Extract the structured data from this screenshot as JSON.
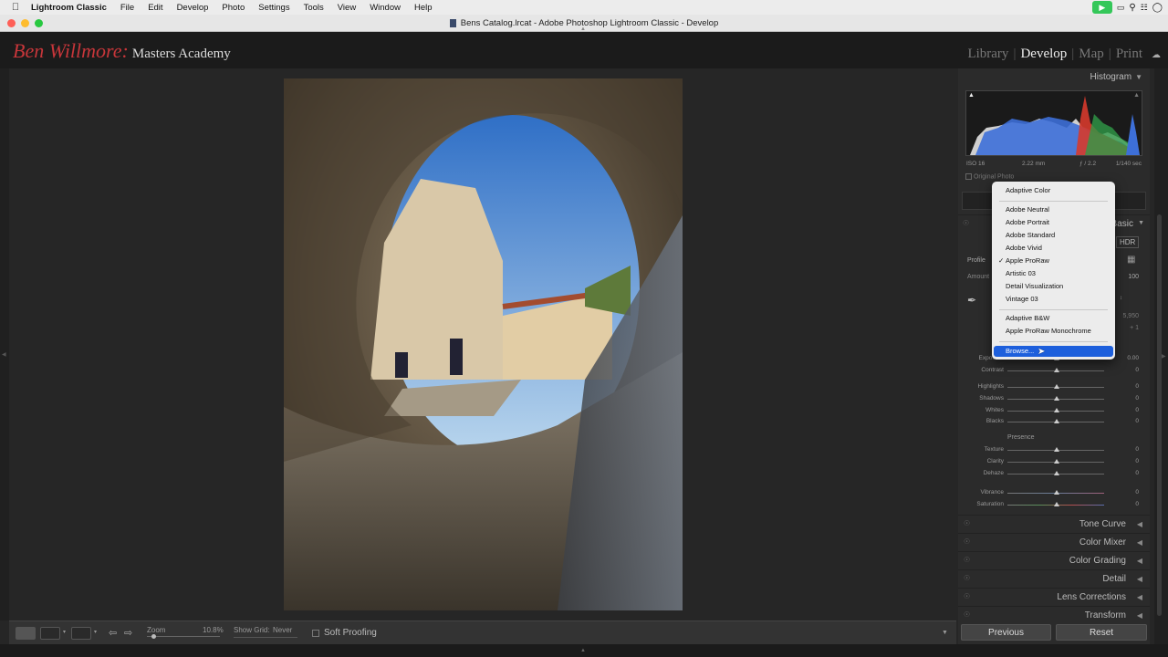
{
  "menubar": {
    "app": "Lightroom Classic",
    "items": [
      "File",
      "Edit",
      "Develop",
      "Photo",
      "Settings",
      "Tools",
      "View",
      "Window",
      "Help"
    ]
  },
  "window": {
    "title": "Bens Catalog.lrcat - Adobe Photoshop Lightroom Classic - Develop"
  },
  "branding": {
    "name": "Ben Willmore:",
    "subtitle": "Masters Academy"
  },
  "modules": {
    "library": "Library",
    "develop": "Develop",
    "map": "Map",
    "print": "Print",
    "separator": "|"
  },
  "histogram": {
    "title": "Histogram",
    "iso": "ISO 16",
    "focal": "2.22 mm",
    "aperture": "ƒ / 2.2",
    "shutter": "1/140 sec",
    "original_photo": "Original Photo"
  },
  "basic": {
    "title": "Basic",
    "hdr": "HDR",
    "profile_label": "Profile",
    "amount_label": "Amount",
    "amount_value": "100",
    "temp_value": "5,950",
    "tint_value": "+ 1",
    "presence_label": "Presence",
    "sliders_tone": [
      {
        "label": "Exposure",
        "value": "0.00"
      },
      {
        "label": "Contrast",
        "value": "0"
      },
      {
        "label": "Highlights",
        "value": "0"
      },
      {
        "label": "Shadows",
        "value": "0"
      },
      {
        "label": "Whites",
        "value": "0"
      },
      {
        "label": "Blacks",
        "value": "0"
      }
    ],
    "sliders_presence": [
      {
        "label": "Texture",
        "value": "0"
      },
      {
        "label": "Clarity",
        "value": "0"
      },
      {
        "label": "Dehaze",
        "value": "0"
      },
      {
        "label": "Vibrance",
        "value": "0"
      },
      {
        "label": "Saturation",
        "value": "0"
      }
    ]
  },
  "panels": [
    "Tone Curve",
    "Color Mixer",
    "Color Grading",
    "Detail",
    "Lens Corrections",
    "Transform"
  ],
  "buttons": {
    "previous": "Previous",
    "reset": "Reset"
  },
  "toolbar": {
    "zoom_label": "Zoom",
    "zoom_value": "10.8%",
    "show_grid_label": "Show Grid:",
    "show_grid_value": "Never",
    "soft_proofing": "Soft Proofing"
  },
  "profile_menu": {
    "items": [
      {
        "label": "Adaptive Color"
      },
      {
        "label": "Adobe Neutral"
      },
      {
        "label": "Adobe Portrait"
      },
      {
        "label": "Adobe Standard"
      },
      {
        "label": "Adobe Vivid"
      },
      {
        "label": "Apple ProRaw",
        "checked": true
      },
      {
        "label": "Artistic 03"
      },
      {
        "label": "Detail Visualization"
      },
      {
        "label": "Vintage 03"
      },
      {
        "label": "Adaptive B&W"
      },
      {
        "label": "Apple ProRaw Monochrome"
      },
      {
        "label": "Browse...",
        "selected": true
      }
    ],
    "check_glyph": "✓"
  },
  "colors": {
    "brand_red": "#c7363a",
    "menu_highlight": "#1d5fdc"
  }
}
